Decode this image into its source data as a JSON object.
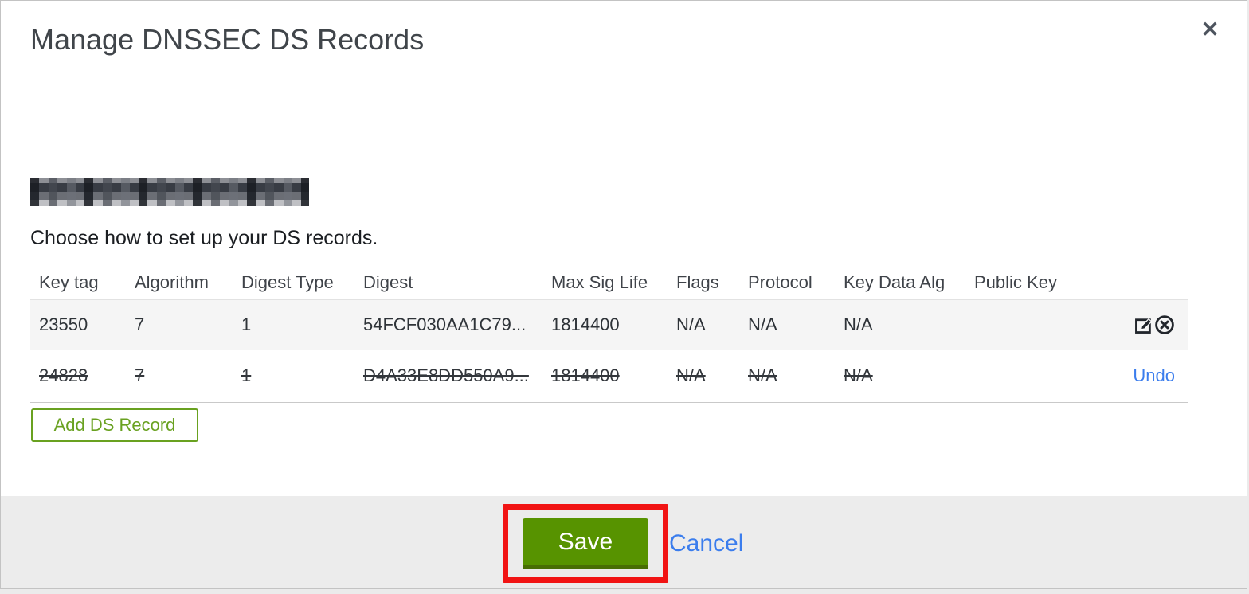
{
  "modal": {
    "title": "Manage DNSSEC DS Records",
    "close_glyph": "✕",
    "intro": "Choose how to set up your DS records."
  },
  "table": {
    "headers": [
      "Key tag",
      "Algorithm",
      "Digest Type",
      "Digest",
      "Max Sig Life",
      "Flags",
      "Protocol",
      "Key Data Alg",
      "Public Key"
    ],
    "rows": [
      {
        "state": "normal",
        "cells": [
          "23550",
          "7",
          "1",
          "54FCF030AA1C79...",
          "1814400",
          "N/A",
          "N/A",
          "N/A",
          ""
        ]
      },
      {
        "state": "deleted",
        "cells": [
          "24828",
          "7",
          "1",
          "D4A33E8DD550A9...",
          "1814400",
          "N/A",
          "N/A",
          "N/A",
          ""
        ],
        "undo_label": "Undo"
      }
    ]
  },
  "buttons": {
    "add_ds_record": "Add DS Record",
    "save": "Save",
    "cancel": "Cancel"
  },
  "icons": {
    "edit": "edit-icon",
    "delete": "delete-icon",
    "close": "close-icon"
  },
  "colors": {
    "save_green": "#579300",
    "save_green_dark": "#486e04",
    "outline_green": "#69a120",
    "link_blue": "#3b7ded",
    "annotation_red": "#f11414",
    "row_stripe": "#f5f5f5",
    "footer_gray": "#ececec"
  }
}
